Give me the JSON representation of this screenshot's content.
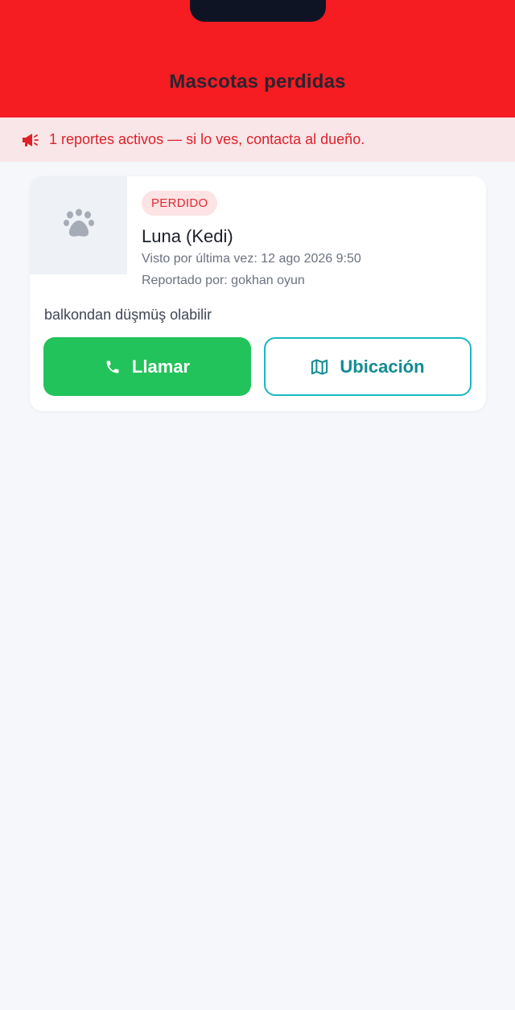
{
  "header": {
    "title": "Mascotas perdidas"
  },
  "banner": {
    "icon": "megaphone-icon",
    "text": "1 reportes activos — si lo ves, contacta al dueño."
  },
  "reports": [
    {
      "status": "PERDIDO",
      "name": "Luna (Kedi)",
      "last_seen": "Visto por última vez: 12 ago 2026 9:50",
      "reported_by": "Reportado por: gokhan oyun",
      "description": "balkondan düşmüş olabilir",
      "photo_icon": "paw-icon",
      "call_label": "Llamar",
      "call_icon": "phone-icon",
      "location_label": "Ubicación",
      "location_icon": "map-icon"
    }
  ],
  "colors": {
    "header_bg": "#f51c22",
    "banner_bg": "#f8e6e8",
    "banner_text": "#e0202a",
    "call_button": "#22c35a",
    "location_border": "#19b8c0",
    "location_text": "#128b93",
    "badge_bg": "#fde3e4",
    "badge_text": "#df2a32"
  }
}
